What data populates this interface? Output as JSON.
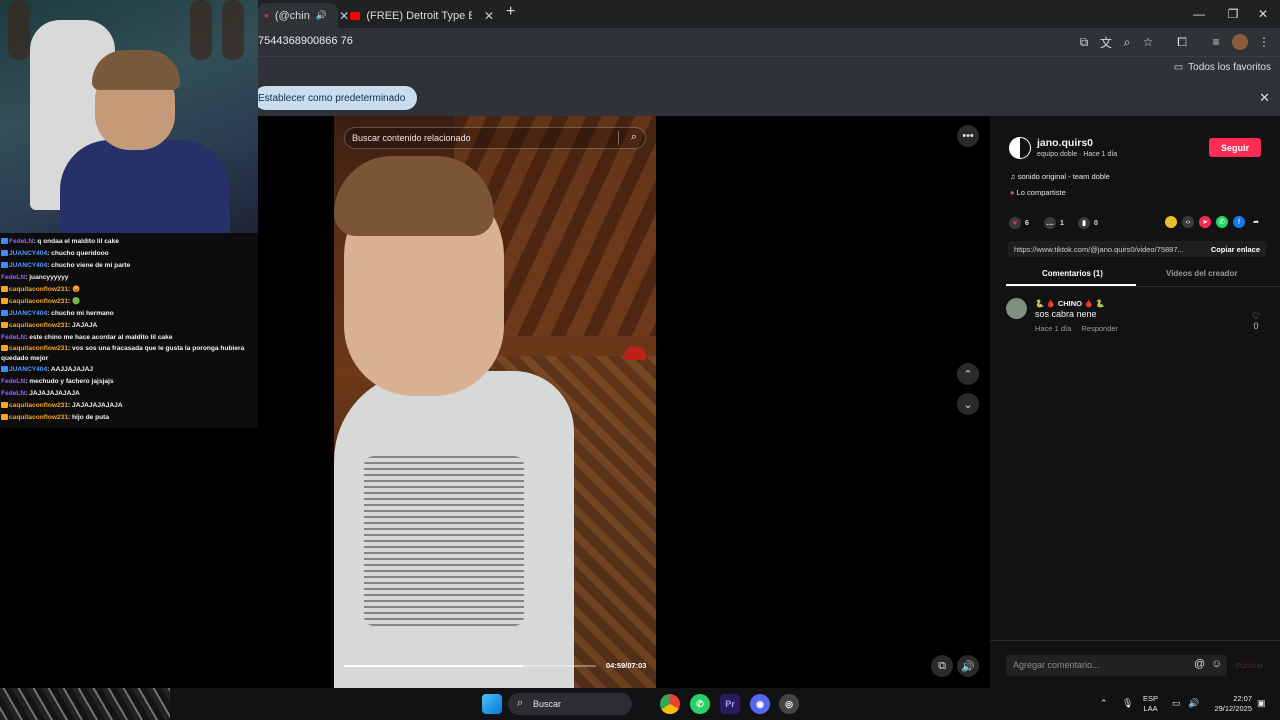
{
  "browser": {
    "tabs": [
      {
        "label": "(@chin"
      },
      {
        "label": "(FREE) Detroit Type Beat x Yn Ja"
      }
    ],
    "url": "7544368900866 76",
    "favorites_label": "Todos los favoritos",
    "default_prompt": "Establecer como predeterminado"
  },
  "chat": [
    {
      "user": "FedeLN",
      "msg": ": q ondaa el maldito lil cake",
      "color": "#9a62ff",
      "badge": "#3c8cff"
    },
    {
      "user": "JUANCY404",
      "msg": ": chucho queridooo",
      "color": "#4f9bff",
      "badge": "#3c8cff"
    },
    {
      "user": "JUANCY404",
      "msg": ": chucho viene de mi parte",
      "color": "#4f9bff",
      "badge": "#3c8cff"
    },
    {
      "user": "FedeLN",
      "msg": ": juancyyyyyy",
      "color": "#9a62ff",
      "badge": ""
    },
    {
      "user": "caquitaconflow231",
      "msg": ": 😡",
      "color": "#f5a623",
      "badge": "#f5a623"
    },
    {
      "user": "caquitaconflow231",
      "msg": ": 🟢",
      "color": "#f5a623",
      "badge": "#f5a623"
    },
    {
      "user": "JUANCY404",
      "msg": ": chucho mi hermano",
      "color": "#4f9bff",
      "badge": "#3c8cff"
    },
    {
      "user": "caquitaconflow231",
      "msg": ": JAJAJA",
      "color": "#f5a623",
      "badge": "#f5a623"
    },
    {
      "user": "FedeLN",
      "msg": ": este chino me hace acordar al maldito lil cake",
      "color": "#9a62ff",
      "badge": ""
    },
    {
      "user": "caquitaconflow231",
      "msg": ": vos sos una fracasada que le gusta la poronga hubiera quedado mejor",
      "color": "#f5a623",
      "badge": "#f5a623",
      "wrap": true
    },
    {
      "user": "JUANCY404",
      "msg": ": AAJJAJAJAJ",
      "color": "#4f9bff",
      "badge": "#3c8cff"
    },
    {
      "user": "FedeLN",
      "msg": ": mechudo y fachero jajsjajs",
      "color": "#9a62ff",
      "badge": ""
    },
    {
      "user": "FedeLN",
      "msg": ": JAJAJAJAJAJA",
      "color": "#9a62ff",
      "badge": ""
    },
    {
      "user": "caquitaconflow231",
      "msg": ": JAJAJAJAJAJA",
      "color": "#f5a623",
      "badge": "#f5a623"
    },
    {
      "user": "caquitaconflow231",
      "msg": ": hijo de puta",
      "color": "#f5a623",
      "badge": "#f5a623"
    }
  ],
  "video": {
    "search_placeholder": "Buscar contenido relacionado",
    "time": "04:59/07:03",
    "progress": 0.71
  },
  "panel": {
    "username": "jano.quirs0",
    "subtitle": "equipo doble · Hace 1 día",
    "follow": "Seguir",
    "sound": "sonido original - team doble",
    "shared": "Lo compartiste",
    "likes": "6",
    "comments": "1",
    "saves": "0",
    "link": "https://www.tiktok.com/@jano.quirs0/video/75887...",
    "copy": "Copiar enlace",
    "tab_comments": "Comentarios (1)",
    "tab_creator": "Videos del creador",
    "comment": {
      "name": "🐍 🩸 CHINO 🩸 🐍",
      "text": "sos cabra nene",
      "time": "Hace 1 día",
      "reply": "Responder",
      "likes": "0"
    },
    "input_placeholder": "Agregar comentario...",
    "publish": "Publicar"
  },
  "taskbar": {
    "search": "Buscar",
    "lang1": "ESP",
    "lang2": "LAA",
    "time": "22:07",
    "date": "29/12/2025"
  }
}
